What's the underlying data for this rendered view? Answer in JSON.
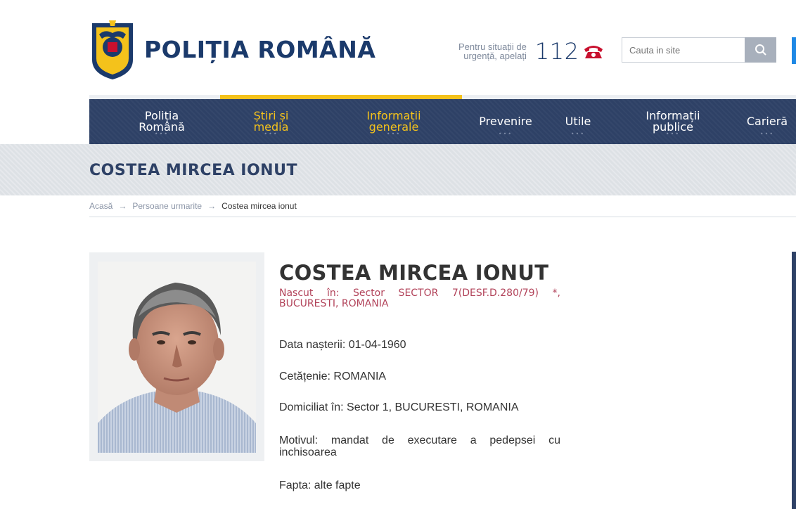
{
  "header": {
    "logo_text": "POLIȚIA ROMÂNĂ",
    "emergency_text_line1": "Pentru situații de",
    "emergency_text_line2": "urgență, apelați",
    "emergency_number": "112",
    "search_placeholder": "Cauta in site",
    "icons": {
      "logo": "police-crest-icon",
      "phone": "phone-icon",
      "search": "search-icon"
    }
  },
  "nav": {
    "items": [
      {
        "line1": "Poliția",
        "line2": "Română",
        "active": false
      },
      {
        "line1": "Știri și",
        "line2": "media",
        "active": true
      },
      {
        "line1": "Informații",
        "line2": "generale",
        "active": true
      },
      {
        "line1": "Prevenire",
        "line2": "",
        "active": false
      },
      {
        "line1": "Utile",
        "line2": "",
        "active": false
      },
      {
        "line1": "Informații",
        "line2": "publice",
        "active": false
      },
      {
        "line1": "Carieră",
        "line2": "",
        "active": false
      }
    ],
    "dots": "•••"
  },
  "page": {
    "title": "COSTEA MIRCEA IONUT"
  },
  "breadcrumb": {
    "items": [
      "Acasă",
      "Persoane urmarite",
      "Costea mircea ionut"
    ],
    "separator": "→"
  },
  "profile": {
    "name": "COSTEA MIRCEA IONUT",
    "born": "Nascut în: Sector SECTOR 7(DESF.D.280/79) *, BUCURESTI, ROMANIA",
    "birth_date": "Data nașterii: 01-04-1960",
    "citizenship": "Cetățenie: ROMANIA",
    "domicile": "Domiciliat în: Sector 1, BUCURESTI, ROMANIA",
    "reason": "Motivul: mandat de executare a pedepsei cu inchisoarea",
    "deed": "Fapta: alte fapte"
  },
  "colors": {
    "navy": "#2e4166",
    "accent_yellow": "#f4c21b",
    "accent_red": "#b2435a",
    "accent_blue": "#1e88e5"
  }
}
